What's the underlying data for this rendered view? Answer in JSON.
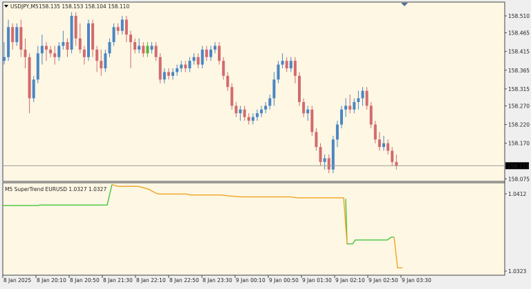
{
  "main_panel": {
    "symbol_label": "USDJPY,M5",
    "ohlc_label": "158.135 158.153 158.104 158.110",
    "current_price_label": "158.110",
    "current_price_value": 158.11,
    "y_ticks": [
      "158.510",
      "158.465",
      "158.415",
      "158.365",
      "158.315",
      "158.270",
      "158.220",
      "158.170",
      "158.120",
      "158.075"
    ],
    "y_tick_values": [
      158.51,
      158.465,
      158.415,
      158.365,
      158.315,
      158.27,
      158.22,
      158.17,
      158.12,
      158.075
    ],
    "colors": {
      "bg": "#fdf7e4",
      "bull": "#4b86c3",
      "bull_last": "#59b540",
      "bear": "#d26b6e",
      "price_line": "#9a9a9a",
      "price_box_bg": "#000000",
      "price_box_text": "#ffffff"
    }
  },
  "indicator_panel": {
    "label": "M5 SuperTrend EURUSD 1.0327 1.0327",
    "y_ticks": [
      "1.0412",
      "1.0323"
    ],
    "y_tick_values": [
      1.0412,
      1.0323
    ],
    "colors": {
      "bg": "#fdf7e4",
      "up": "#45c43a",
      "down": "#f2a31c"
    }
  },
  "time_axis": {
    "labels": [
      "8 Jan 2025",
      "8 Jan 20:10",
      "8 Jan 20:50",
      "8 Jan 21:30",
      "8 Jan 22:10",
      "8 Jan 22:50",
      "8 Jan 23:30",
      "9 Jan 00:10",
      "9 Jan 00:50",
      "9 Jan 01:30",
      "9 Jan 02:10",
      "9 Jan 02:50",
      "9 Jan 03:30"
    ]
  },
  "chart_data": [
    {
      "type": "candlestick",
      "title": "USDJPY,M5",
      "ylim": [
        158.07,
        158.545
      ],
      "candles": [
        [
          158.39,
          158.44,
          158.38,
          158.4
        ],
        [
          158.4,
          158.5,
          158.39,
          158.48
        ],
        [
          158.48,
          158.49,
          158.42,
          158.44
        ],
        [
          158.44,
          158.49,
          158.43,
          158.48
        ],
        [
          158.48,
          158.5,
          158.4,
          158.42
        ],
        [
          158.42,
          158.45,
          158.37,
          158.4
        ],
        [
          158.4,
          158.41,
          158.25,
          158.29
        ],
        [
          158.29,
          158.35,
          158.28,
          158.34
        ],
        [
          158.34,
          158.43,
          158.33,
          158.41
        ],
        [
          158.41,
          158.46,
          158.38,
          158.43
        ],
        [
          158.43,
          158.44,
          158.39,
          158.42
        ],
        [
          158.42,
          158.43,
          158.4,
          158.41
        ],
        [
          158.41,
          158.43,
          158.38,
          158.4
        ],
        [
          158.4,
          158.44,
          158.39,
          158.43
        ],
        [
          158.43,
          158.47,
          158.42,
          158.44
        ],
        [
          158.44,
          158.45,
          158.4,
          158.42
        ],
        [
          158.42,
          158.52,
          158.41,
          158.51
        ],
        [
          158.51,
          158.52,
          158.43,
          158.45
        ],
        [
          158.45,
          158.49,
          158.41,
          158.42
        ],
        [
          158.42,
          158.43,
          158.38,
          158.4
        ],
        [
          158.4,
          158.5,
          158.39,
          158.49
        ],
        [
          158.49,
          158.5,
          158.4,
          158.42
        ],
        [
          158.42,
          158.43,
          158.36,
          158.39
        ],
        [
          158.39,
          158.42,
          158.35,
          158.37
        ],
        [
          158.37,
          158.42,
          158.36,
          158.41
        ],
        [
          158.41,
          158.45,
          158.4,
          158.44
        ],
        [
          158.44,
          158.49,
          158.43,
          158.48
        ],
        [
          158.48,
          158.49,
          158.46,
          158.47
        ],
        [
          158.47,
          158.51,
          158.46,
          158.5
        ],
        [
          158.5,
          158.51,
          158.44,
          158.46
        ],
        [
          158.46,
          158.47,
          158.37,
          158.44
        ],
        [
          158.44,
          158.45,
          158.41,
          158.42
        ],
        [
          158.42,
          158.45,
          158.41,
          158.43
        ],
        [
          158.43,
          158.44,
          158.4,
          158.41
        ],
        [
          158.41,
          158.44,
          158.4,
          158.43
        ],
        [
          158.42,
          158.44,
          158.41,
          158.43
        ],
        [
          158.43,
          158.44,
          158.39,
          158.4
        ],
        [
          158.4,
          158.41,
          158.33,
          158.34
        ],
        [
          158.34,
          158.37,
          158.33,
          158.36
        ],
        [
          158.36,
          158.37,
          158.34,
          158.35
        ],
        [
          158.35,
          158.37,
          158.34,
          158.36
        ],
        [
          158.36,
          158.38,
          158.35,
          158.37
        ],
        [
          158.37,
          158.39,
          158.36,
          158.38
        ],
        [
          158.38,
          158.39,
          158.36,
          158.37
        ],
        [
          158.37,
          158.4,
          158.36,
          158.39
        ],
        [
          158.39,
          158.41,
          158.38,
          158.4
        ],
        [
          158.4,
          158.41,
          158.37,
          158.38
        ],
        [
          158.38,
          158.43,
          158.37,
          158.42
        ],
        [
          158.42,
          158.43,
          158.39,
          158.4
        ],
        [
          158.4,
          158.43,
          158.39,
          158.42
        ],
        [
          158.42,
          158.44,
          158.41,
          158.43
        ],
        [
          158.43,
          158.44,
          158.38,
          158.39
        ],
        [
          158.39,
          158.4,
          158.34,
          158.35
        ],
        [
          158.35,
          158.36,
          158.31,
          158.32
        ],
        [
          158.32,
          158.33,
          158.26,
          158.27
        ],
        [
          158.27,
          158.28,
          158.24,
          158.25
        ],
        [
          158.25,
          158.27,
          158.23,
          158.26
        ],
        [
          158.26,
          158.27,
          158.23,
          158.24
        ],
        [
          158.24,
          158.25,
          158.22,
          158.23
        ],
        [
          158.23,
          158.25,
          158.22,
          158.24
        ],
        [
          158.24,
          158.26,
          158.23,
          158.25
        ],
        [
          158.25,
          158.27,
          158.24,
          158.26
        ],
        [
          158.26,
          158.28,
          158.25,
          158.27
        ],
        [
          158.27,
          158.3,
          158.26,
          158.29
        ],
        [
          158.29,
          158.36,
          158.27,
          158.34
        ],
        [
          158.34,
          158.39,
          158.33,
          158.38
        ],
        [
          158.38,
          158.41,
          158.37,
          158.39
        ],
        [
          158.39,
          158.4,
          158.36,
          158.37
        ],
        [
          158.37,
          158.4,
          158.36,
          158.39
        ],
        [
          158.39,
          158.4,
          158.33,
          158.35
        ],
        [
          158.35,
          158.36,
          158.27,
          158.28
        ],
        [
          158.28,
          158.29,
          158.24,
          158.25
        ],
        [
          158.25,
          158.27,
          158.23,
          158.26
        ],
        [
          158.26,
          158.27,
          158.19,
          158.2
        ],
        [
          158.2,
          158.21,
          158.15,
          158.16
        ],
        [
          158.16,
          158.17,
          158.11,
          158.12
        ],
        [
          158.12,
          158.14,
          158.1,
          158.13
        ],
        [
          158.13,
          158.14,
          158.09,
          158.1
        ],
        [
          158.1,
          158.19,
          158.09,
          158.18
        ],
        [
          158.18,
          158.23,
          158.16,
          158.22
        ],
        [
          158.22,
          158.27,
          158.21,
          158.26
        ],
        [
          158.26,
          158.29,
          158.24,
          158.27
        ],
        [
          158.27,
          158.3,
          158.25,
          158.26
        ],
        [
          158.26,
          158.29,
          158.25,
          158.28
        ],
        [
          158.28,
          158.31,
          158.26,
          158.29
        ],
        [
          158.29,
          158.32,
          158.27,
          158.31
        ],
        [
          158.31,
          158.32,
          158.26,
          158.27
        ],
        [
          158.27,
          158.28,
          158.21,
          158.22
        ],
        [
          158.22,
          158.23,
          158.17,
          158.18
        ],
        [
          158.18,
          158.2,
          158.15,
          158.16
        ],
        [
          158.16,
          158.19,
          158.15,
          158.17
        ],
        [
          158.17,
          158.18,
          158.14,
          158.15
        ],
        [
          158.15,
          158.16,
          158.11,
          158.12
        ],
        [
          158.12,
          158.14,
          158.1,
          158.11
        ]
      ]
    },
    {
      "type": "line",
      "title": "M5 SuperTrend EURUSD 1.0327 1.0327",
      "ylim": [
        1.032,
        1.0415
      ],
      "series": [
        {
          "color": "#45c43a",
          "values": [
            1.0392,
            1.0392,
            1.0392,
            1.0392,
            1.0392,
            1.0392,
            1.0392,
            1.0392,
            1.0392,
            1.0392,
            1.0392,
            1.0392,
            1.0392,
            1.0392,
            1.0392,
            1.0392,
            1.0392,
            1.0392,
            1.0392,
            1.0392,
            1.0392,
            1.0392,
            1.0392,
            1.0392,
            1.0392,
            1.0392,
            1.0392,
            1.0392,
            1.0392,
            1.0392,
            1.0392,
            1.0392,
            1.0392,
            1.0392,
            1.0392,
            1.0392,
            1.0392,
            1.0392,
            1.0392,
            1.0392,
            1.0392,
            1.0392,
            1.0392,
            1.0392,
            1.0392,
            1.0392,
            1.0392,
            1.0392,
            1.0392,
            1.0392,
            1.0392,
            1.0392,
            1.0392,
            1.0392,
            1.0392,
            1.0392,
            1.0392,
            1.0392,
            1.0392,
            1.0392,
            1.0392,
            1.0392,
            1.0392,
            1.0392,
            1.0392,
            1.0392,
            1.0392,
            1.0392,
            1.0392,
            1.0392,
            1.0392,
            1.0392,
            1.0392,
            1.0392,
            1.0392,
            1.0392,
            1.0392,
            1.0392,
            1.0352,
            1.0352,
            1.0352,
            1.0356,
            1.0356,
            1.0356,
            1.0356,
            1.0356,
            1.0356,
            1.0356,
            1.0359,
            1.0359
          ]
        },
        {
          "color": "#f2a31c",
          "values": [
            1.0414,
            1.0412,
            1.0411,
            1.0409,
            1.0408,
            1.0406,
            1.0405,
            1.0405,
            1.0404,
            1.0403,
            1.0403,
            1.0403,
            1.0402,
            1.0402,
            1.0401,
            1.0401,
            1.0401,
            1.0401,
            1.0401,
            1.0401,
            1.0401,
            1.0401,
            1.0401,
            1.0401,
            1.0401,
            1.0401,
            1.0401,
            1.0401,
            1.0401,
            1.0401,
            1.0401,
            1.0401,
            1.0401,
            1.0401,
            1.0401,
            1.0401,
            1.0401,
            1.0401,
            1.0352,
            1.0327,
            1.0327
          ]
        }
      ]
    }
  ]
}
